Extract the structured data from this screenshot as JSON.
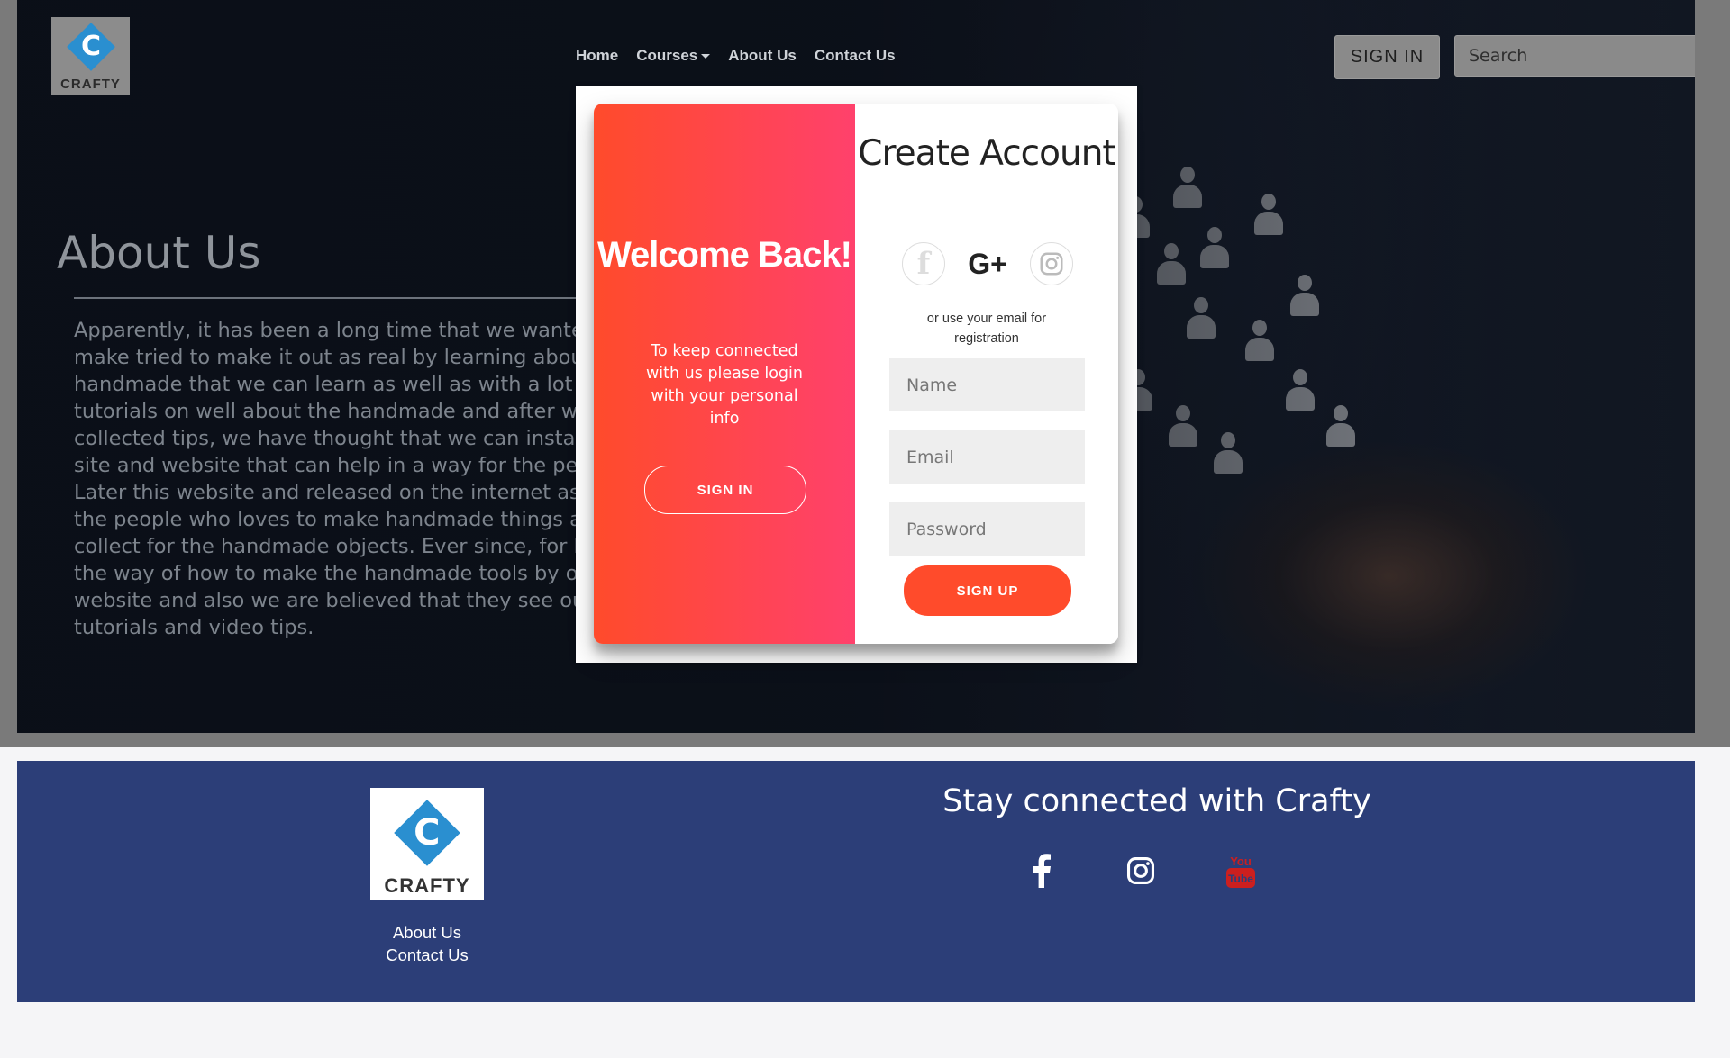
{
  "brand": {
    "logo_text": "CRAFTY",
    "logo_letter": "C"
  },
  "nav": {
    "links": [
      "Home",
      "Courses",
      "About Us",
      "Contact Us"
    ],
    "sign_in_label": "SIGN IN",
    "search_placeholder": "Search"
  },
  "about": {
    "title": "About Us",
    "body": "Apparently, it has been a long time that we wanted to make tried to make it out as real by learning about the handmade that we can learn as well as with a lot of tutorials on well about the handmade and after we have collected tips, we have thought that we can install this site and website that can help in a way for the people. Later this website and released on the internet as a free the people who loves to make handmade things and to collect for the handmade objects. Ever since, for learn the way of how to make the handmade tools by our website and also we are believed that they see our tutorials and video tips."
  },
  "modal": {
    "welcome_title": "Welcome Back!",
    "welcome_text": "To keep connected with us please login with your personal info",
    "sign_in_button": "SIGN IN",
    "create_title": "Create Account",
    "social_icons": [
      "facebook-icon",
      "google-plus-icon",
      "instagram-icon"
    ],
    "google_label": "G+",
    "facebook_label": "f",
    "hint": "or use your email for registration",
    "name_placeholder": "Name",
    "email_placeholder": "Email",
    "password_placeholder": "Password",
    "sign_up_button": "SIGN UP"
  },
  "footer": {
    "links": [
      "About Us",
      "Contact Us"
    ],
    "stay_connected": "Stay connected with Crafty",
    "social_icons": [
      "facebook-icon",
      "instagram-icon",
      "youtube-icon"
    ]
  },
  "colors": {
    "accent": "#ff4b2b",
    "accent_end": "#ff416c",
    "footer_bg": "#2c3e78",
    "logo_blue": "#2a8fd0",
    "youtube_red": "#cc1f1f"
  }
}
